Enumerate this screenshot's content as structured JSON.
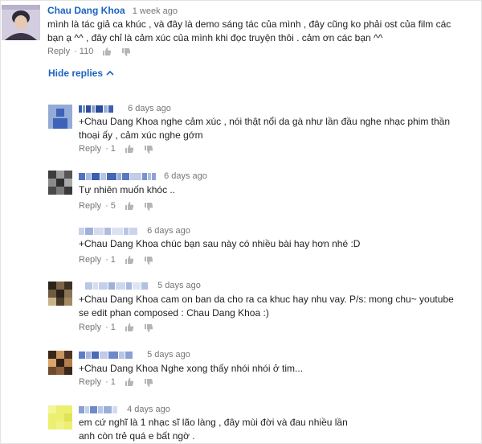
{
  "icons": {
    "like": "thumbs-up-icon",
    "dislike": "thumbs-down-icon",
    "collapse": "chevron-up-icon"
  },
  "colors": {
    "link": "#1a63c2",
    "meta": "#767676",
    "text": "#222222"
  },
  "top_comment": {
    "author": "Chau Dang Khoa",
    "time": "1 week ago",
    "text_line1": "mình là tác giả ca khúc , và đây là demo sáng tác của mình , đây cũng ko phải ost của film các",
    "text_line2": "bạn ạ ^^ , đây chỉ là cảm xúc của mình khi đọc truyện thôi . cảm ơn các bạn ^^",
    "reply_label": "Reply",
    "likes": "110"
  },
  "hide_replies_label": "Hide replies",
  "replies": [
    {
      "time": "6 days ago",
      "line1": "+Chau  Dang Khoa nghe cảm xúc , nói thật nổi da gà như lần đầu nghe nhạc phim thần",
      "line2": "thoại ấy , cảm xúc nghe gớm",
      "reply_label": "Reply",
      "likes": "1"
    },
    {
      "time": "6 days ago",
      "line1": "Tự nhiên muốn khóc ..",
      "line2": "",
      "reply_label": "Reply",
      "likes": "5"
    },
    {
      "time": "6 days ago",
      "line1": "+Chau  Dang Khoa chúc bạn sau này có nhiều bài hay hơn nhé :D",
      "line2": "",
      "reply_label": "Reply",
      "likes": "1"
    },
    {
      "time": "5 days ago",
      "line1": "+Chau  Dang Khoa cam on ban da cho ra ca khuc hay nhu vay. P/s: mong chu~ youtube",
      "line2": "se edit phan composed : Chau Dang Khoa :)",
      "reply_label": "Reply",
      "likes": "1"
    },
    {
      "time": "5 days ago",
      "line1": "+Chau  Dang Khoa Nghe xong thấy nhói nhói ở tim...",
      "line2": "",
      "reply_label": "Reply",
      "likes": "1"
    },
    {
      "time": "4 days ago",
      "line1": "em cứ nghĩ là 1 nhạc sĩ lão làng , đây mùi đời và đau nhiều lần",
      "line2": "anh còn trẻ quá e bất ngờ .",
      "reply_label": "",
      "likes": ""
    }
  ]
}
